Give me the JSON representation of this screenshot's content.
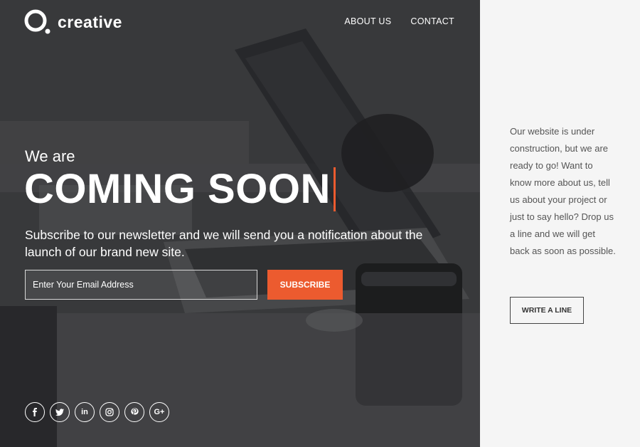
{
  "brand": {
    "name": "creative",
    "icon": "logo-ring-icon"
  },
  "nav": {
    "items": [
      "ABOUT US",
      "CONTACT"
    ]
  },
  "hero": {
    "kicker": "We are",
    "headline": "COMING SOON",
    "subtitle": "Subscribe to our newsletter and we will send you a notification about the launch of our brand new site."
  },
  "form": {
    "email_placeholder": "Enter Your Email Address",
    "submit_label": "SUBSCRIBE"
  },
  "socials": [
    {
      "icon": "facebook-icon"
    },
    {
      "icon": "twitter-icon"
    },
    {
      "icon": "linkedin-icon",
      "glyph": "in"
    },
    {
      "icon": "instagram-icon"
    },
    {
      "icon": "pinterest-icon"
    },
    {
      "icon": "google-plus-icon",
      "glyph": "G+"
    }
  ],
  "side": {
    "text": "Our website is under construction, but we are ready to go! Want to know more about us, tell us about your project or just to say hello? Drop us a line and we will get back as soon as possible.",
    "button_label": "WRITE A LINE"
  },
  "colors": {
    "accent": "#ec5b2f",
    "hero_overlay": "#3e3f42",
    "side_bg": "#f5f5f5",
    "side_text": "#555555"
  }
}
